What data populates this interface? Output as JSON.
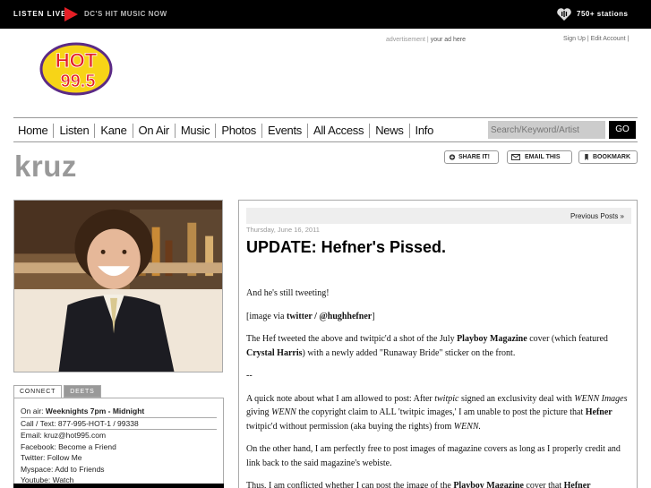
{
  "topbar": {
    "listen_live": "LISTEN LIVE",
    "tagline": "DC'S HIT MUSIC NOW",
    "stations": "750+ stations",
    "iheart_icon": "iheart-icon",
    "play_icon": "play-icon"
  },
  "ad": {
    "advertisement": "advertisement",
    "separator": " | ",
    "your_ad": "your ad here"
  },
  "account": {
    "sign_up": "Sign Up",
    "sep": " | ",
    "edit_account": "Edit Account",
    "trail": " |"
  },
  "logo": {
    "line1": "HOT",
    "line2": "99.5"
  },
  "nav": {
    "items": [
      "Home",
      "Listen",
      "Kane",
      "On Air",
      "Music",
      "Photos",
      "Events",
      "All Access",
      "News",
      "Info"
    ],
    "search_placeholder": "Search/Keyword/Artist",
    "go_label": "GO"
  },
  "page_title": "kruz",
  "share": {
    "share_it": "SHARE IT!",
    "email_this": "EMAIL THIS",
    "bookmark": "BOOKMARK"
  },
  "tabs": {
    "connect": "CONNECT",
    "deets": "DEETS"
  },
  "connect": {
    "on_air_label": "On air:",
    "on_air_value": "Weeknights 7pm - Midnight",
    "call_label": "Call / Text:",
    "call_value": "877-995-HOT-1 / 99338",
    "email_label": "Email:",
    "email_value": "kruz@hot995.com",
    "facebook_label": "Facebook:",
    "facebook_value": "Become a Friend",
    "twitter_label": "Twitter:",
    "twitter_value": "Follow Me",
    "myspace_label": "Myspace:",
    "myspace_value": "Add to Friends",
    "youtube_label": "Youtube:",
    "youtube_value": "Watch"
  },
  "post": {
    "previous_posts": "Previous Posts »",
    "date": "Thursday, June 16, 2011",
    "title": "UPDATE: Hefner's Pissed.",
    "p1": "And he's still tweeting!",
    "p2_a": "[image via ",
    "p2_b": "twitter / @hughhefner",
    "p2_c": "]",
    "p3_a": "The Hef tweeted the above and twitpic'd a shot of the July ",
    "p3_b": "Playboy Magazine",
    "p3_c": " cover (which featured ",
    "p3_d": "Crystal Harris",
    "p3_e": ") with a newly added \"Runaway Bride\" sticker on the front.",
    "p4": "--",
    "p5_a": "A quick note about what I am allowed to post: After ",
    "p5_b": "twitpic",
    "p5_c": " signed an exclusivity deal with ",
    "p5_d": "WENN Images",
    "p5_e": " giving ",
    "p5_f": "WENN",
    "p5_g": " the copyright claim to ALL 'twitpic images,' I am unable to post the picture that ",
    "p5_h": "Hefner",
    "p5_i": " twitpic'd without permission (aka buying the rights) from ",
    "p5_j": "WENN.",
    "p6": "On the other hand, I am perfectly free to post images of magazine covers as long as I properly credit and link back to the said magazine's webiste.",
    "p7_a": "Thus, I am conflicted whether I can post the image of the ",
    "p7_b": "Playboy Magazine",
    "p7_c": " cover that ",
    "p7_d": "Hefner"
  },
  "colors": {
    "accent_red": "#e41f26",
    "logo_yellow": "#f7d417",
    "logo_purple": "#5b2a86"
  }
}
